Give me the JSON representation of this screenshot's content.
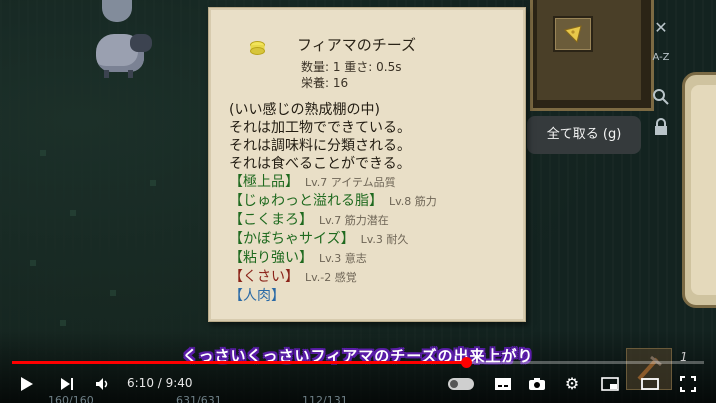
{
  "item": {
    "name": "フィアマのチーズ",
    "quantity_weight": "数量: 1  重さ: 0.5s",
    "nutrition": "栄養: 16",
    "description": [
      "(いい感じの熟成棚の中)",
      "それは加工物でできている。",
      "それは調味料に分類される。",
      "それは食べることができる。"
    ],
    "traits": [
      {
        "name": "【極上品】",
        "level": "Lv.7 アイテム品質",
        "tone": "good"
      },
      {
        "name": "【じゅわっと溢れる脂】",
        "level": "Lv.8 筋力",
        "tone": "good"
      },
      {
        "name": "【こくまろ】",
        "level": "Lv.7 筋力潜在",
        "tone": "good"
      },
      {
        "name": "【かぼちゃサイズ】",
        "level": "Lv.3 耐久",
        "tone": "good"
      },
      {
        "name": "【粘り強い】",
        "level": "Lv.3 意志",
        "tone": "good"
      },
      {
        "name": "【くさい】",
        "level": "Lv.-2 感覚",
        "tone": "bad"
      },
      {
        "name": "【人肉】",
        "level": "",
        "tone": "blue"
      }
    ],
    "icon": "cheese-icon"
  },
  "container": {
    "take_all_label": "全て取る (g)",
    "side_icons": [
      "close-icon",
      "sort-icon",
      "search-icon",
      "lock-icon"
    ],
    "sort_label": "A-Z"
  },
  "subtitle": "くっさいくっさいフィアマのチーズの出来上がり",
  "player": {
    "time_display": "6:10 / 9:40",
    "progress_fraction": 0.656,
    "autoplay_on": false,
    "corner_count": "1",
    "bottom_stats": [
      "160/160",
      "631/631",
      "112/131"
    ]
  },
  "colors": {
    "progress": "#ff0000",
    "trait_good": "#1f6a1f",
    "trait_bad": "#8a2218",
    "trait_special": "#2a6aa6",
    "subtitle_outline": "#5a1ca8"
  }
}
